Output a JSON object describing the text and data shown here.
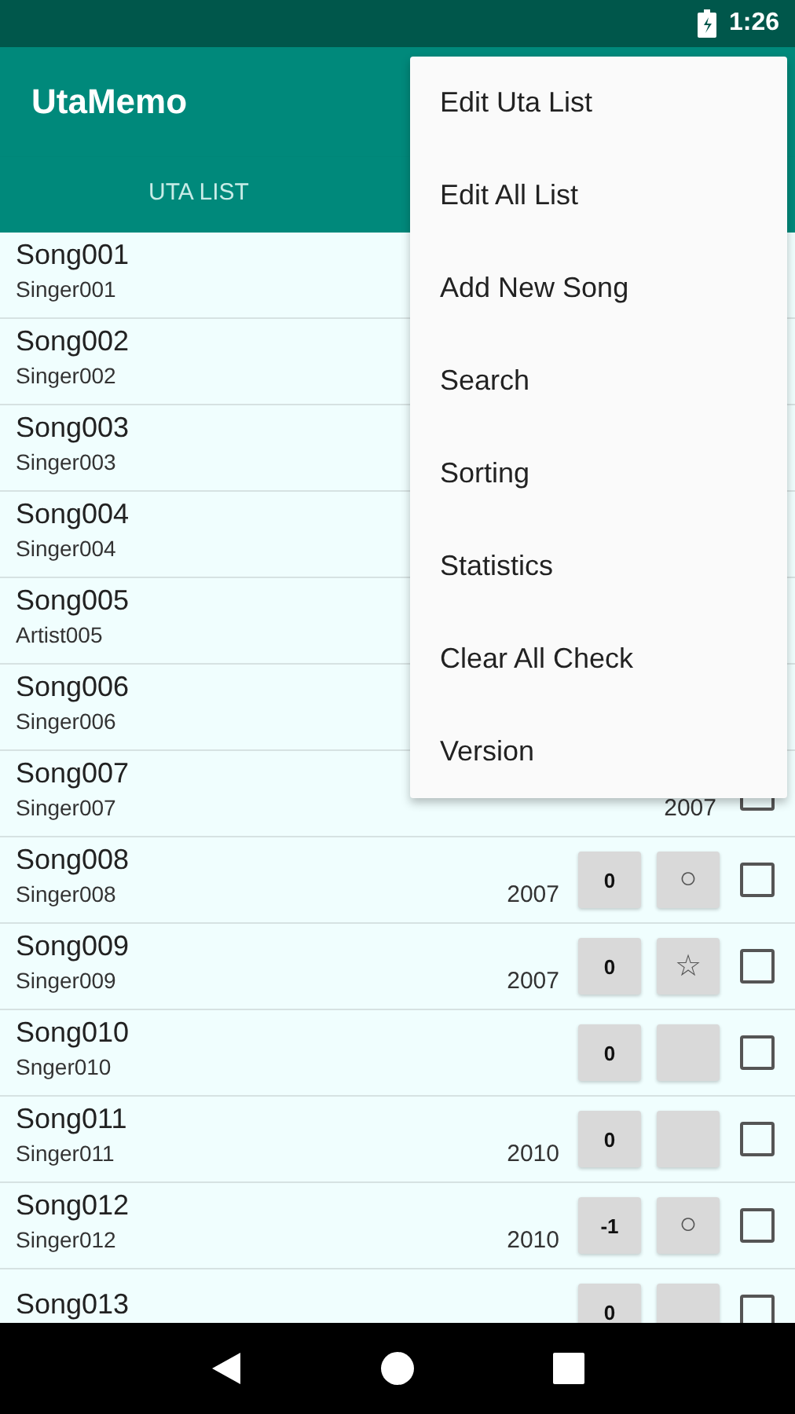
{
  "status_bar": {
    "time": "1:26"
  },
  "app_bar": {
    "title": "UtaMemo"
  },
  "tabs": [
    {
      "label": "UTA LIST",
      "selected": false
    }
  ],
  "songs": [
    {
      "title": "Song001",
      "singer": "Singer001"
    },
    {
      "title": "Song002",
      "singer": "Singer002"
    },
    {
      "title": "Song003",
      "singer": "Singer003"
    },
    {
      "title": "Song004",
      "singer": "Singer004"
    },
    {
      "title": "Song005",
      "singer": "Artist005"
    },
    {
      "title": "Song006",
      "singer": "Singer006"
    },
    {
      "title": "Song007",
      "singer": "Singer007",
      "year": "2007",
      "checked": false
    },
    {
      "title": "Song008",
      "singer": "Singer008",
      "year": "2007",
      "count": "0",
      "symbol": "○",
      "checked": false
    },
    {
      "title": "Song009",
      "singer": "Singer009",
      "year": "2007",
      "count": "0",
      "symbol": "☆",
      "checked": false
    },
    {
      "title": "Song010",
      "singer": "Snger010",
      "count": "0",
      "checked": false
    },
    {
      "title": "Song011",
      "singer": "Singer011",
      "year": "2010",
      "count": "0",
      "checked": false
    },
    {
      "title": "Song012",
      "singer": "Singer012",
      "year": "2010",
      "count": "-1",
      "symbol": "○",
      "checked": false
    },
    {
      "title": "Song013",
      "count": "0",
      "checked": false
    }
  ],
  "menu": {
    "items": [
      "Edit Uta List",
      "Edit All List",
      "Add New Song",
      "Search",
      "Sorting",
      "Statistics",
      "Clear All Check",
      "Version"
    ]
  }
}
